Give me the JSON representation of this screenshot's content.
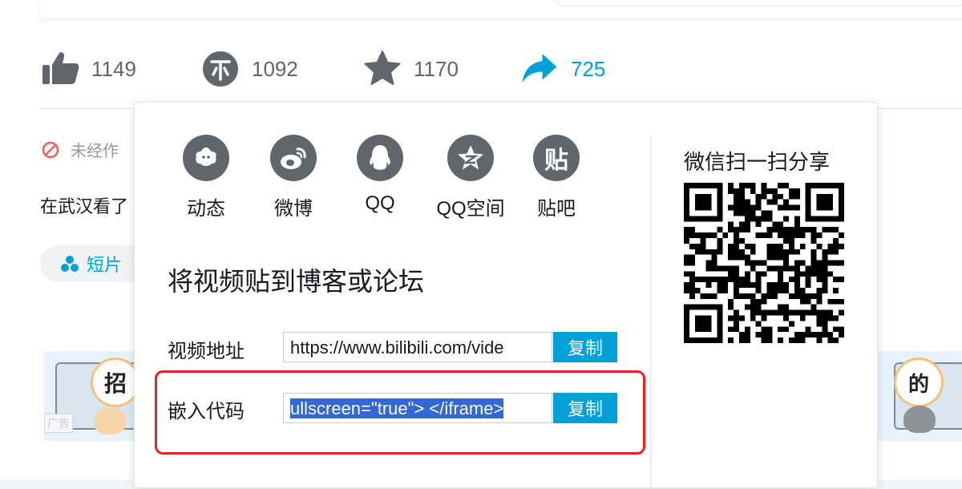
{
  "actions": {
    "like_count": "1149",
    "coin_count": "1092",
    "favorite_count": "1170",
    "share_count": "725",
    "share_color": "#00a1d6"
  },
  "info": {
    "copyright_text": "未经作",
    "description": "在武汉看了",
    "tag_label": "短片"
  },
  "ads": {
    "left_bubble": "招",
    "left_ad_label": "广告",
    "right_bubble": "的"
  },
  "share": {
    "targets": [
      {
        "label": "动态",
        "icon": "dynamic-icon"
      },
      {
        "label": "微博",
        "icon": "weibo-icon"
      },
      {
        "label": "QQ",
        "icon": "qq-icon"
      },
      {
        "label": "QQ空间",
        "icon": "qzone-icon"
      },
      {
        "label": "贴吧",
        "icon": "tieba-icon"
      }
    ],
    "tieba_glyph": "贴",
    "embed_title": "将视频贴到博客或论坛",
    "url_label": "视频地址",
    "url_value": "https://www.bilibili.com/vide",
    "embed_label": "嵌入代码",
    "embed_value": "ullscreen=\"true\"> </iframe>",
    "copy_label": "复制",
    "qr_title": "微信扫一扫分享",
    "highlight_color": "#e6231e"
  }
}
